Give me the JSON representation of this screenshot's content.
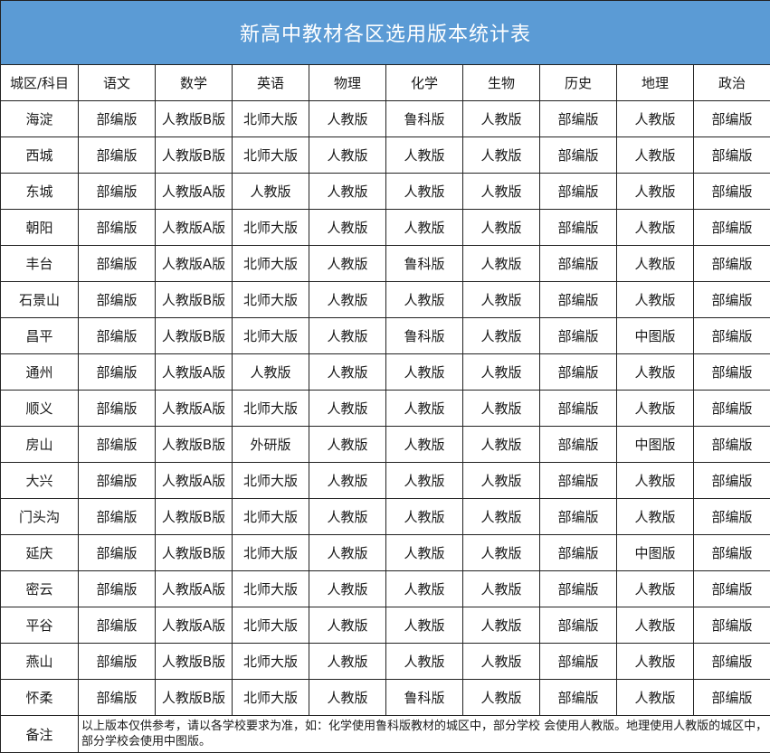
{
  "title": "新高中教材各区选用版本统计表",
  "header": [
    "城区/科目",
    "语文",
    "数学",
    "英语",
    "物理",
    "化学",
    "生物",
    "历史",
    "地理",
    "政治"
  ],
  "rows": [
    [
      "海淀",
      "部编版",
      "人教版B版",
      "北师大版",
      "人教版",
      "鲁科版",
      "人教版",
      "部编版",
      "人教版",
      "部编版"
    ],
    [
      "西城",
      "部编版",
      "人教版B版",
      "北师大版",
      "人教版",
      "人教版",
      "人教版",
      "部编版",
      "人教版",
      "部编版"
    ],
    [
      "东城",
      "部编版",
      "人教版A版",
      "人教版",
      "人教版",
      "人教版",
      "人教版",
      "部编版",
      "人教版",
      "部编版"
    ],
    [
      "朝阳",
      "部编版",
      "人教版A版",
      "北师大版",
      "人教版",
      "人教版",
      "人教版",
      "部编版",
      "人教版",
      "部编版"
    ],
    [
      "丰台",
      "部编版",
      "人教版A版",
      "北师大版",
      "人教版",
      "鲁科版",
      "人教版",
      "部编版",
      "人教版",
      "部编版"
    ],
    [
      "石景山",
      "部编版",
      "人教版B版",
      "北师大版",
      "人教版",
      "人教版",
      "人教版",
      "部编版",
      "人教版",
      "部编版"
    ],
    [
      "昌平",
      "部编版",
      "人教版B版",
      "北师大版",
      "人教版",
      "鲁科版",
      "人教版",
      "部编版",
      "中图版",
      "部编版"
    ],
    [
      "通州",
      "部编版",
      "人教版A版",
      "人教版",
      "人教版",
      "人教版",
      "人教版",
      "部编版",
      "人教版",
      "部编版"
    ],
    [
      "顺义",
      "部编版",
      "人教版A版",
      "北师大版",
      "人教版",
      "人教版",
      "人教版",
      "部编版",
      "人教版",
      "部编版"
    ],
    [
      "房山",
      "部编版",
      "人教版B版",
      "外研版",
      "人教版",
      "人教版",
      "人教版",
      "部编版",
      "中图版",
      "部编版"
    ],
    [
      "大兴",
      "部编版",
      "人教版A版",
      "北师大版",
      "人教版",
      "人教版",
      "人教版",
      "部编版",
      "人教版",
      "部编版"
    ],
    [
      "门头沟",
      "部编版",
      "人教版B版",
      "北师大版",
      "人教版",
      "人教版",
      "人教版",
      "部编版",
      "人教版",
      "部编版"
    ],
    [
      "延庆",
      "部编版",
      "人教版B版",
      "北师大版",
      "人教版",
      "人教版",
      "人教版",
      "部编版",
      "中图版",
      "部编版"
    ],
    [
      "密云",
      "部编版",
      "人教版A版",
      "北师大版",
      "人教版",
      "人教版",
      "人教版",
      "部编版",
      "人教版",
      "部编版"
    ],
    [
      "平谷",
      "部编版",
      "人教版A版",
      "北师大版",
      "人教版",
      "人教版",
      "人教版",
      "部编版",
      "人教版",
      "部编版"
    ],
    [
      "燕山",
      "部编版",
      "人教版B版",
      "北师大版",
      "人教版",
      "人教版",
      "人教版",
      "部编版",
      "人教版",
      "部编版"
    ],
    [
      "怀柔",
      "部编版",
      "人教版B版",
      "北师大版",
      "人教版",
      "鲁科版",
      "人教版",
      "部编版",
      "人教版",
      "部编版"
    ]
  ],
  "note": {
    "label": "备注",
    "text": "以上版本仅供参考，请以各学校要求为准，如：化学使用鲁科版教材的城区中，部分学校 会使用人教版。地理使用人教版的城区中，部分学校会使用中图版。"
  },
  "colors": {
    "title_background": "#5b9bd5",
    "title_text": "#ffffff",
    "grid_line": "#222222"
  }
}
